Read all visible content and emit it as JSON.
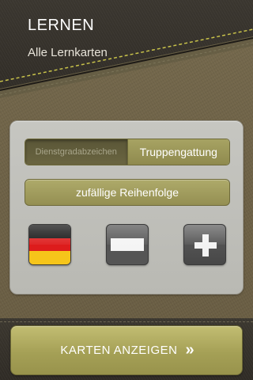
{
  "header": {
    "title": "LERNEN",
    "subtitle": "Alle Lernkarten"
  },
  "filter": {
    "segments": [
      {
        "label": "Dienstgradabzeichen",
        "selected": false
      },
      {
        "label": "Truppengattung",
        "selected": true
      }
    ],
    "random_order_label": "zufällige Reihenfolge"
  },
  "language_buttons": [
    {
      "icon": "german-flag-icon"
    },
    {
      "icon": "white-bar-flag-icon"
    },
    {
      "icon": "plus-icon"
    }
  ],
  "footer": {
    "show_cards_label": "KARTEN ANZEIGEN",
    "chevron": "»"
  },
  "colors": {
    "accent_olive": "#a5a056",
    "header_dark": "#312d27",
    "stitch_yellow": "#c8c24a"
  }
}
